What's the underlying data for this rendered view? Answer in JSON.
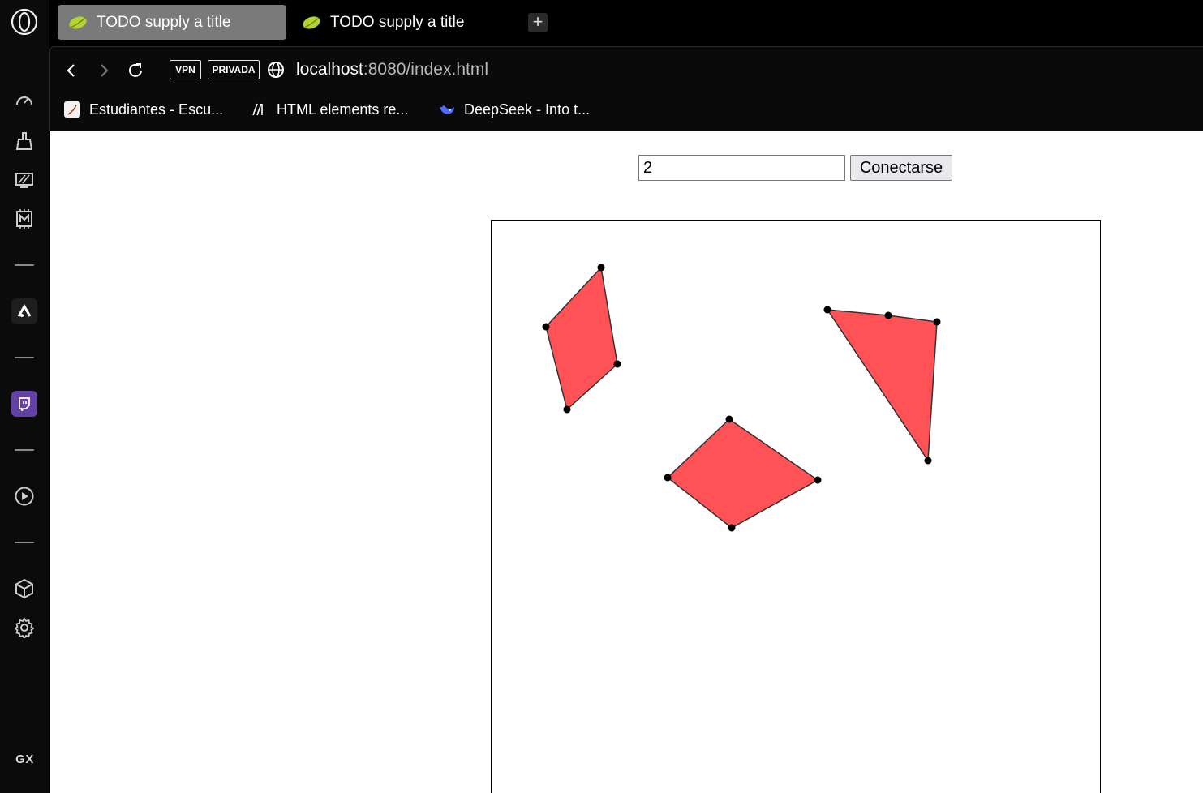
{
  "tabs": [
    {
      "title": "TODO supply a title",
      "active": true
    },
    {
      "title": "TODO supply a title",
      "active": false
    }
  ],
  "new_tab_label": "+",
  "toolbar": {
    "vpn_label": "VPN",
    "private_label": "PRIVADA",
    "url_host": "localhost",
    "url_rest": ":8080/index.html"
  },
  "bookmarks": [
    {
      "label": "Estudiantes - Escu...",
      "icon": "document-icon"
    },
    {
      "label": "HTML elements re...",
      "icon": "mdn-icon"
    },
    {
      "label": "DeepSeek - Into t...",
      "icon": "deepseek-whale-icon"
    }
  ],
  "sidebar": {
    "items": [
      "speed-dial-icon",
      "cleaner-icon",
      "hotkeys-icon",
      "ram-limiter-icon",
      "aria-icon",
      "twitch-icon",
      "player-icon",
      "extensions-icon",
      "settings-icon"
    ],
    "gx_label": "GX"
  },
  "page": {
    "input_value": "2",
    "connect_label": "Conectarse"
  },
  "colors": {
    "polygon_fill": "#ff5257",
    "polygon_stroke": "#333333",
    "vertex": "#000000",
    "twitch": "#6441a5"
  }
}
